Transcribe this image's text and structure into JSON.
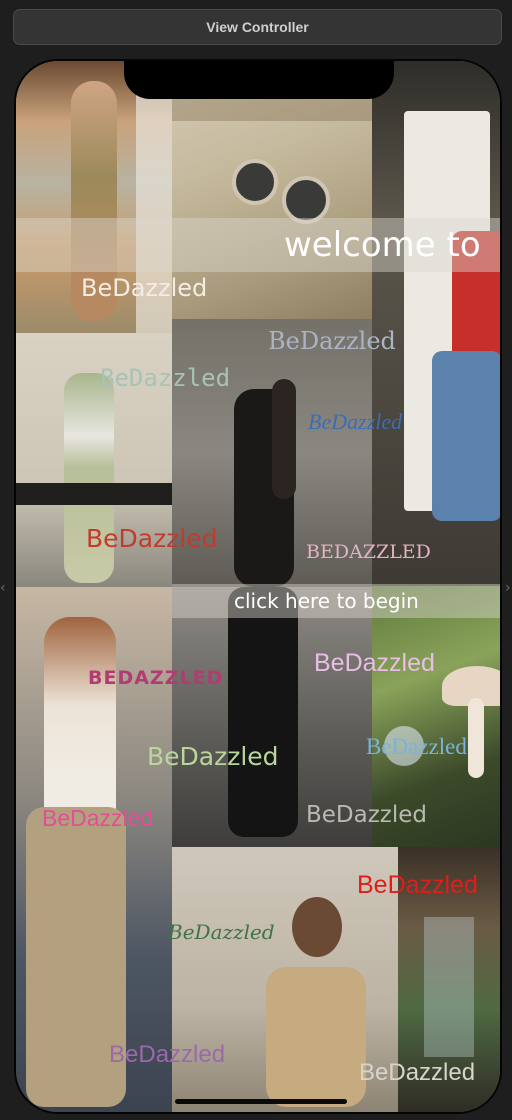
{
  "window": {
    "title": "View Controller"
  },
  "screen": {
    "welcome_text": "welcome to",
    "begin_button_label": "click here to begin"
  },
  "brand_marks": [
    {
      "name": "brand-text-1",
      "text": "BeDazzled",
      "color": "#f3ece2"
    },
    {
      "name": "brand-text-2",
      "text": "BeDazzled",
      "color": "#aab4c4"
    },
    {
      "name": "brand-text-3",
      "text": "BeDazzled",
      "color": "#a7c3b4"
    },
    {
      "name": "brand-text-4",
      "text": "BeDazzled",
      "color": "#3b6db5"
    },
    {
      "name": "brand-text-5",
      "text": "BeDazzled",
      "color": "#c23b2f"
    },
    {
      "name": "brand-text-6",
      "text": "BEDAZZLED",
      "color": "#e3b3c4"
    },
    {
      "name": "brand-text-7",
      "text": "BEDAZZLED",
      "color": "#b23b74"
    },
    {
      "name": "brand-text-8",
      "text": "BeDazzled",
      "color": "#e7bfe4"
    },
    {
      "name": "brand-text-9",
      "text": "BeDazzled",
      "color": "#7ab3dc"
    },
    {
      "name": "brand-text-10",
      "text": "BeDazzled",
      "color": "#b9d69b"
    },
    {
      "name": "brand-text-11",
      "text": "BeDazzled",
      "color": "#e24f97"
    },
    {
      "name": "brand-text-12",
      "text": "BeDazzled",
      "color": "#b9b9b0"
    },
    {
      "name": "brand-text-13",
      "text": "BeDazzled",
      "color": "#e21d19"
    },
    {
      "name": "brand-text-14",
      "text": "BeDazzled",
      "color": "#3f7349"
    },
    {
      "name": "brand-text-15",
      "text": "BeDazzled",
      "color": "#9a6aa8"
    },
    {
      "name": "brand-text-16",
      "text": "BeDazzled",
      "color": "#d8d4cc"
    }
  ]
}
